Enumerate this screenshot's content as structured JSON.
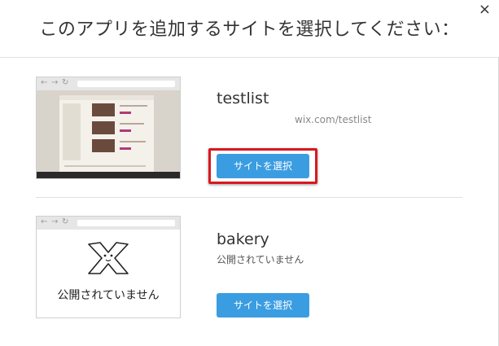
{
  "dialog": {
    "title": "このアプリを追加するサイトを選択してください：",
    "close_glyph": "×"
  },
  "sites": [
    {
      "name": "testlist",
      "url": "wix.com/testlist",
      "button_label": "サイトを選択",
      "highlighted": true
    },
    {
      "name": "bakery",
      "status": "公開されていません",
      "thumbnail_text": "公開されていません",
      "button_label": "サイトを選択"
    }
  ],
  "browser_nav": {
    "back": "←",
    "forward": "→",
    "refresh": "↻"
  },
  "colors": {
    "button_bg": "#3b9de1",
    "highlight_border": "#d71920",
    "button_text": "#ffffff"
  }
}
